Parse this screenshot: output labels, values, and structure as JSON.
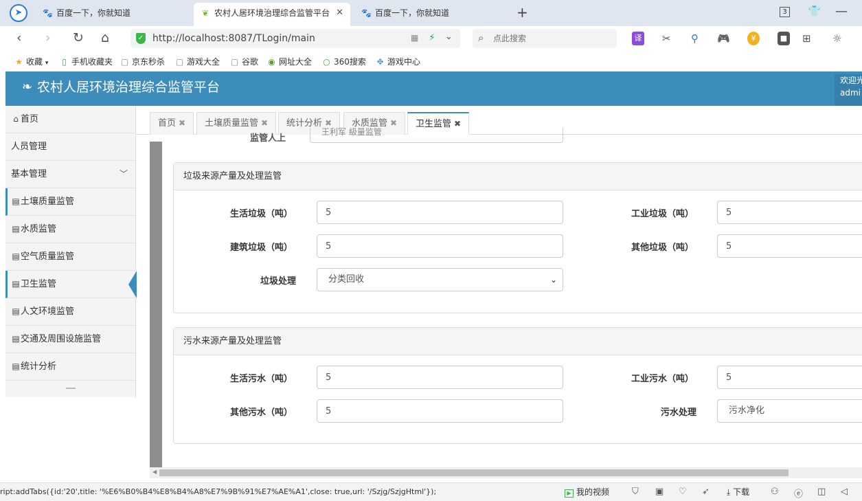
{
  "browser": {
    "tabs": [
      {
        "label": "百度一下，你就知道"
      },
      {
        "label": "农村人居环境治理综合监管平台"
      },
      {
        "label": "百度一下，你就知道"
      }
    ],
    "window_count": "3",
    "url": "http://localhost:8087/TLogin/main",
    "search_placeholder": "点此搜索",
    "translate_label": "译",
    "coin_label": "¥",
    "bookmarks": [
      {
        "label": "收藏",
        "icon": "star-icon"
      },
      {
        "label": "手机收藏夹",
        "icon": "phone-icon"
      },
      {
        "label": "京东秒杀",
        "icon": "page-icon"
      },
      {
        "label": "游戏大全",
        "icon": "page-icon"
      },
      {
        "label": "谷歌",
        "icon": "page-icon"
      },
      {
        "label": "网址大全",
        "icon": "web-icon"
      },
      {
        "label": "360搜索",
        "icon": "search-360-icon"
      },
      {
        "label": "游戏中心",
        "icon": "game-icon"
      }
    ]
  },
  "header": {
    "title": "农村人居环境治理综合监管平台",
    "welcome": "欢迎光",
    "user": "admi"
  },
  "sidebar": {
    "items": [
      {
        "label": "首页"
      },
      {
        "label": "人员管理"
      },
      {
        "label": "基本管理"
      },
      {
        "label": "土壤质量监管"
      },
      {
        "label": "水质监管"
      },
      {
        "label": "空气质量监管"
      },
      {
        "label": "卫生监管"
      },
      {
        "label": "人文环境监管"
      },
      {
        "label": "交通及周围设施监管"
      },
      {
        "label": "统计分析"
      }
    ]
  },
  "content_tabs": [
    {
      "label": "首页"
    },
    {
      "label": "土壤质量监管"
    },
    {
      "label": "统计分析"
    },
    {
      "label": "水质监管"
    },
    {
      "label": "卫生监管"
    }
  ],
  "top_remnant": {
    "label": "监管人上",
    "value": "王利军 級量监管"
  },
  "garbage_panel": {
    "title": "垃圾来源产量及处理监管",
    "domestic_label": "生活垃圾（吨）",
    "domestic_value": "5",
    "industrial_label": "工业垃圾（吨）",
    "industrial_value": "5",
    "construction_label": "建筑垃圾（吨）",
    "construction_value": "5",
    "other_label": "其他垃圾（吨）",
    "other_value": "5",
    "treatment_label": "垃圾处理",
    "treatment_value": "分类回收"
  },
  "sewage_panel": {
    "title": "污水来源产量及处理监管",
    "domestic_label": "生活污水（吨）",
    "domestic_value": "5",
    "industrial_label": "工业污水（吨）",
    "industrial_value": "5",
    "other_label": "其他污水（吨）",
    "other_value": "5",
    "treatment_label": "污水处理",
    "treatment_value": "污水净化"
  },
  "status_bar": {
    "text": "ript:addTabs({id:'20',title: '%E6%B0%B4%E8%B4%A8%E7%9B%91%E7%AE%A1',close: true,url: '/Szjg/SzjgHtml'});",
    "video_label": "我的视频",
    "download_label": "下载"
  },
  "colors": {
    "header_blue": "#3c8dbc",
    "tab_bar": "#dfe6ef"
  }
}
